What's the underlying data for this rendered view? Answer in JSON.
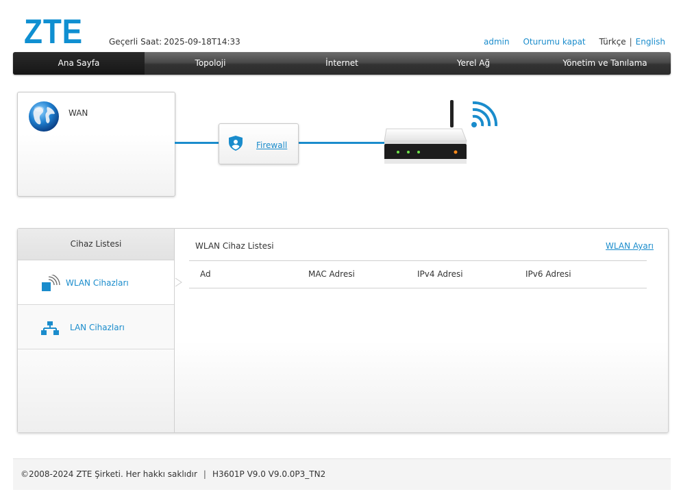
{
  "header": {
    "logo_text": "ZTE",
    "clock_label": "Geçerli Saat:",
    "clock_value": "2025-09-18T14:33",
    "user": "admin",
    "logout": "Oturumu kapat",
    "lang_current": "Türkçe",
    "lang_sep": "|",
    "lang_other": "English"
  },
  "nav": {
    "items": [
      "Ana Sayfa",
      "Topoloji",
      "İnternet",
      "Yerel Ağ",
      "Yönetim ve Tanılama"
    ],
    "active_index": 0
  },
  "topology": {
    "wan_label": "WAN",
    "firewall_link": "Firewall",
    "icons": [
      "globe-icon",
      "shield-icon",
      "router-icon",
      "wifi-signal-icon"
    ]
  },
  "devices": {
    "side_title": "Cihaz Listesi",
    "side_items": [
      {
        "label": "WLAN Cihazları",
        "icon": "wlan-icon"
      },
      {
        "label": "LAN Cihazları",
        "icon": "lan-icon"
      }
    ],
    "list_title": "WLAN Cihaz Listesi",
    "settings_link": "WLAN Ayarı",
    "columns": [
      "Ad",
      "MAC Adresi",
      "IPv4 Adresi",
      "IPv6 Adresi"
    ],
    "rows": []
  },
  "footer": {
    "copyright": "©2008-2024 ZTE Şirketi. Her hakkı saklıdır",
    "sep": "|",
    "version": "H3601P V9.0 V9.0.0P3_TN2"
  },
  "colors": {
    "accent": "#1a8ccc",
    "nav_dark": "#2b2b2b",
    "logo": "#0f8fd1"
  }
}
